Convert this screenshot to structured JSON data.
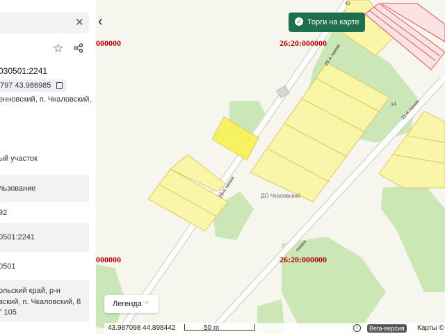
{
  "panel": {
    "cadastral_number": "030501:2241",
    "coordinates": "797 43.986985",
    "address_short": "енновский, п. Чкаловский,",
    "land_type": "ый участок",
    "usage_label": "льзование",
    "area_value": "92",
    "parent_number": "0501:2241",
    "quarter": "0501",
    "address_line1": "ольский край, р-н",
    "address_line2": "вский, п. Чкаловский, 8",
    "address_line3": "° 105"
  },
  "map": {
    "torgi_button": "Торги на карте",
    "red_labels": [
      "000000",
      "26:20:000000",
      "000000",
      "26:20:000000"
    ],
    "street_29": "29-я линия",
    "street_11": "11-я линия",
    "street_bottom": "линия",
    "place_label": "ДО Чкаловский",
    "parcel_43": "43",
    "parcel_14": "14",
    "legend_label": "Легенда",
    "coord_lat": "43.987098",
    "coord_lon": "44.898442",
    "scale_label": "50 m",
    "beta_label": "Beta-версия",
    "maps_label": "Карты © Я",
    "info_icon": "info-icon"
  },
  "colors": {
    "accent_green": "#1f6f4e",
    "cadastre_red": "#b00000",
    "parcel_yellow": "#fbf7a6",
    "parcel_border": "#e0c35a",
    "green_area": "#c8e6b0"
  }
}
